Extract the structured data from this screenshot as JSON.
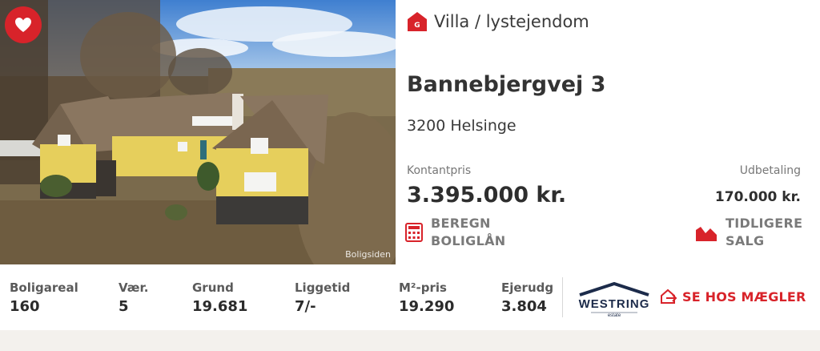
{
  "listing": {
    "property_type": "Villa / lystejendom",
    "address": "Bannebjergvej 3",
    "city": "3200 Helsinge",
    "cash_price_label": "Kontantpris",
    "cash_price": "3.395.000 kr.",
    "down_payment_label": "Udbetaling",
    "down_payment": "170.000 kr.",
    "photo_watermark": "Boligsiden"
  },
  "actions": {
    "calc_loan_line1": "BEREGN",
    "calc_loan_line2": "BOLIGLÅN",
    "prev_sales_line1": "TIDLIGERE",
    "prev_sales_line2": "SALG",
    "see_broker": "SE HOS MÆGLER"
  },
  "stats": [
    {
      "label": "Boligareal",
      "value": "160"
    },
    {
      "label": "Vær.",
      "value": "5"
    },
    {
      "label": "Grund",
      "value": "19.681"
    },
    {
      "label": "Liggetid",
      "value": "7/-"
    },
    {
      "label": "M²-pris",
      "value": "19.290"
    },
    {
      "label": "Ejerudg",
      "value": "3.804"
    }
  ],
  "broker": {
    "logo_text": "WESTRING",
    "logo_sub": "estate"
  },
  "icons": {
    "favorite": "heart-icon",
    "type_badge": "house-g-icon",
    "calculator": "calculator-icon",
    "area_chart": "area-chart-icon",
    "external": "house-arrow-icon"
  },
  "badge_letter": "G",
  "colors": {
    "accent": "#d8232a",
    "house_yellow": "#e6cf5c",
    "thatch": "#8a7660"
  }
}
